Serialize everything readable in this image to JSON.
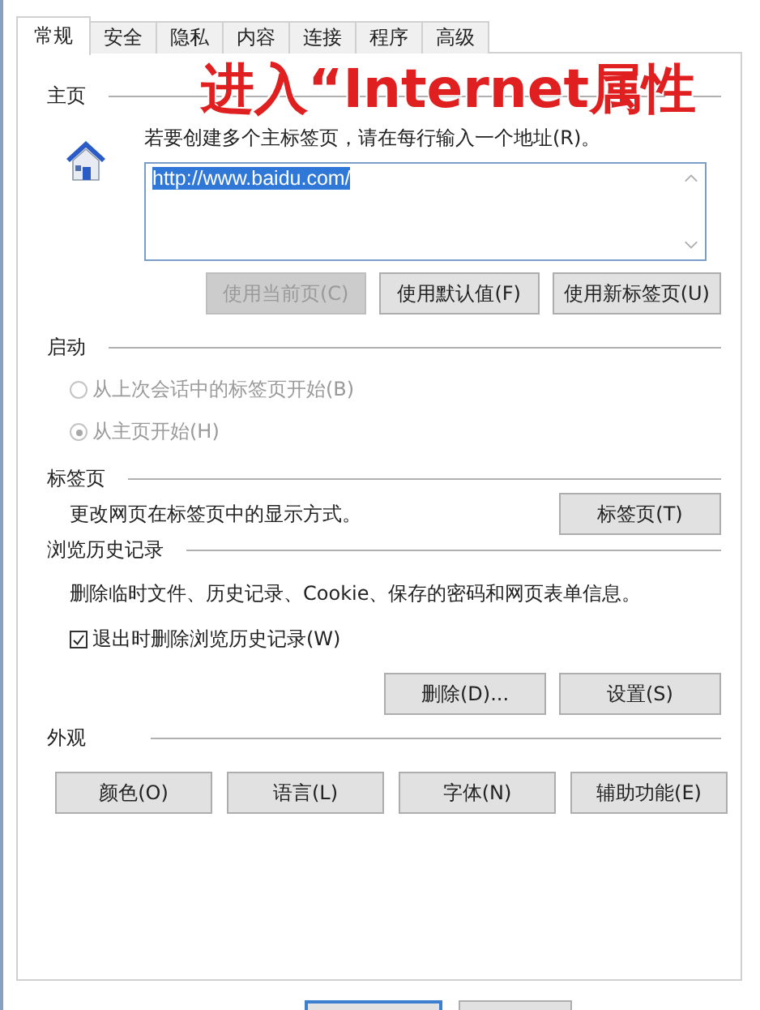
{
  "tabs": [
    {
      "label": "常规",
      "selected": true
    },
    {
      "label": "安全",
      "selected": false
    },
    {
      "label": "隐私",
      "selected": false
    },
    {
      "label": "内容",
      "selected": false
    },
    {
      "label": "连接",
      "selected": false
    },
    {
      "label": "程序",
      "selected": false
    },
    {
      "label": "高级",
      "selected": false
    }
  ],
  "annotation": "进入“Internet属性",
  "homepage": {
    "heading": "主页",
    "instruction": "若要创建多个主标签页，请在每行输入一个地址(R)。",
    "value": "http://www.baidu.com/",
    "buttons": [
      {
        "label": "使用当前页(C)",
        "disabled": true
      },
      {
        "label": "使用默认值(F)",
        "disabled": false
      },
      {
        "label": "使用新标签页(U)",
        "disabled": false
      }
    ]
  },
  "startup": {
    "heading": "启动",
    "options": [
      {
        "label": "从上次会话中的标签页开始(B)",
        "selected": false,
        "disabled": true
      },
      {
        "label": "从主页开始(H)",
        "selected": true,
        "disabled": true
      }
    ]
  },
  "tabs_section": {
    "heading": "标签页",
    "description": "更改网页在标签页中的显示方式。",
    "button": "标签页(T)"
  },
  "history": {
    "heading": "浏览历史记录",
    "description": "删除临时文件、历史记录、Cookie、保存的密码和网页表单信息。",
    "checkbox": {
      "label": "退出时删除浏览历史记录(W)",
      "checked": true
    },
    "buttons": [
      "删除(D)...",
      "设置(S)"
    ]
  },
  "appearance": {
    "heading": "外观",
    "buttons": [
      "颜色(O)",
      "语言(L)",
      "字体(N)",
      "辅助功能(E)"
    ]
  }
}
